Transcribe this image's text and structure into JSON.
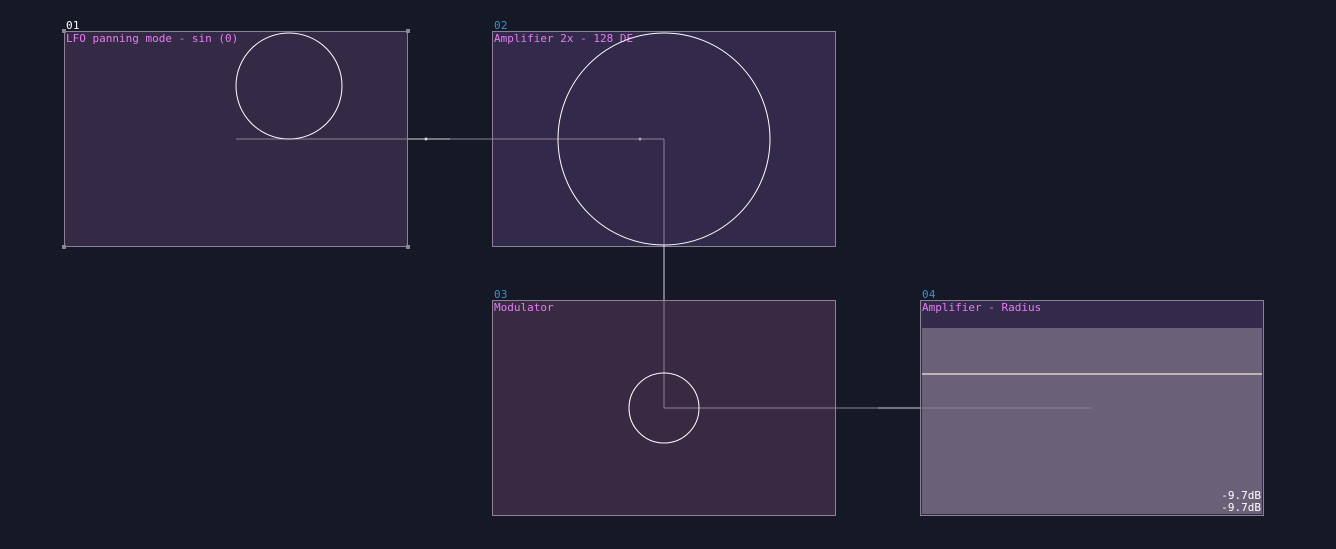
{
  "colors": {
    "background": "#141925",
    "node_border": "#8c8294",
    "title": "#e57cf0",
    "index_selected": "#ffffff",
    "index_default": "#3e8ed0",
    "wire": "#8c8294",
    "shape": "#ffffff"
  },
  "nodes": [
    {
      "index": "01",
      "title": "LFO panning mode - sin (0)",
      "selected": true
    },
    {
      "index": "02",
      "title": "Amplifier 2x - 128 DE",
      "selected": false
    },
    {
      "index": "03",
      "title": "Modulator",
      "selected": false
    },
    {
      "index": "04",
      "title": "Amplifier - Radius",
      "selected": false
    }
  ],
  "meters": {
    "left_db": "-9.7dB",
    "right_db": "-9.7dB"
  }
}
